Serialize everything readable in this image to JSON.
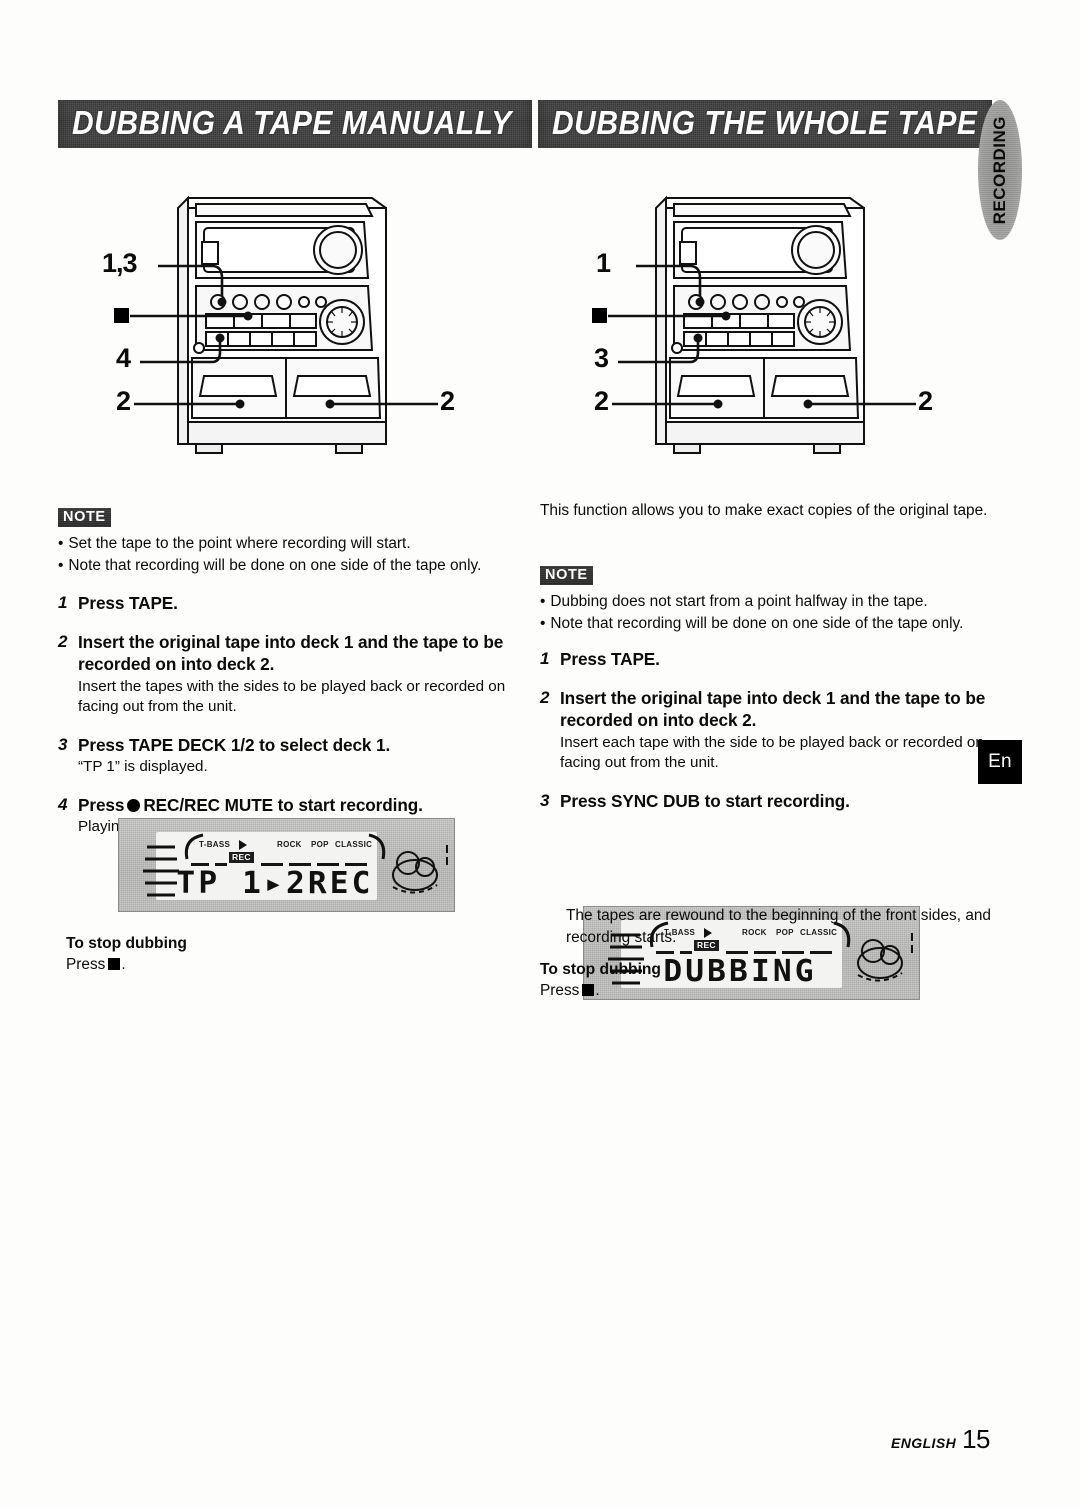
{
  "page": {
    "footer_word": "ENGLISH",
    "footer_number": "15",
    "language_tab": "En",
    "side_tab": "RECORDING"
  },
  "left_column": {
    "heading": "DUBBING A TAPE MANUALLY",
    "diagram": {
      "name": "stereo-front-panel",
      "callouts": [
        {
          "label": "1,3",
          "position": "upper-left"
        },
        {
          "label": "stop-square",
          "position": "mid-left"
        },
        {
          "label": "4",
          "position": "lower-left"
        },
        {
          "label": "2",
          "position": "deck-left"
        },
        {
          "label": "2",
          "position": "deck-right"
        }
      ]
    },
    "note": {
      "badge": "NOTE",
      "items": [
        "Set the tape to the point where recording will start.",
        "Note that recording will be done on one side of the tape only."
      ]
    },
    "steps": [
      {
        "number": "1",
        "title": "Press TAPE.",
        "sub": ""
      },
      {
        "number": "2",
        "title": "Insert the original tape into deck 1 and the tape to be recorded on into deck 2.",
        "sub": "Insert the tapes with the sides to be played back or recorded on facing out from the unit."
      },
      {
        "number": "3",
        "title": "Press TAPE DECK 1/2 to select deck 1.",
        "sub": "“TP 1” is displayed."
      },
      {
        "number": "4",
        "title_before_icon": "Press",
        "title_icon": "record-dot",
        "title_after_icon": "REC/REC MUTE to start recording.",
        "sub": "Playing and recording start simultaneously."
      }
    ],
    "display": {
      "segment_text": "TP 1▸2REC",
      "rec_badge": "REC",
      "labels": [
        "T-BASS",
        "ROCK",
        "POP",
        "CLASSIC"
      ]
    },
    "stop_section": {
      "heading": "To stop dubbing",
      "text_before_icon": "Press",
      "icon": "stop-square",
      "text_after_icon": "."
    }
  },
  "right_column": {
    "heading": "DUBBING THE WHOLE TAPE",
    "diagram": {
      "name": "stereo-front-panel",
      "callouts": [
        {
          "label": "1",
          "position": "upper-left"
        },
        {
          "label": "stop-square",
          "position": "mid-left"
        },
        {
          "label": "3",
          "position": "lower-left"
        },
        {
          "label": "2",
          "position": "deck-left"
        },
        {
          "label": "2",
          "position": "deck-right"
        }
      ]
    },
    "intro": "This function allows you to make exact copies of the original tape.",
    "note": {
      "badge": "NOTE",
      "items": [
        "Dubbing does not start from a point halfway in the tape.",
        "Note that recording will be done on one side of the tape only."
      ]
    },
    "steps": [
      {
        "number": "1",
        "title": "Press TAPE.",
        "sub": ""
      },
      {
        "number": "2",
        "title": "Insert the original tape into deck 1 and the tape to be recorded on into deck 2.",
        "sub": "Insert each tape with the side to be played back or recorded on facing out from the unit."
      },
      {
        "number": "3",
        "title": "Press SYNC DUB to start recording.",
        "sub": ""
      }
    ],
    "display": {
      "segment_text": "DUBBING",
      "rec_badge": "REC",
      "labels": [
        "T-BASS",
        "ROCK",
        "POP",
        "CLASSIC"
      ]
    },
    "after_display": "The tapes are rewound to the beginning of the front sides, and recording starts.",
    "stop_section": {
      "heading": "To stop dubbing",
      "text_before_icon": "Press",
      "icon": "stop-square",
      "text_after_icon": "."
    }
  }
}
